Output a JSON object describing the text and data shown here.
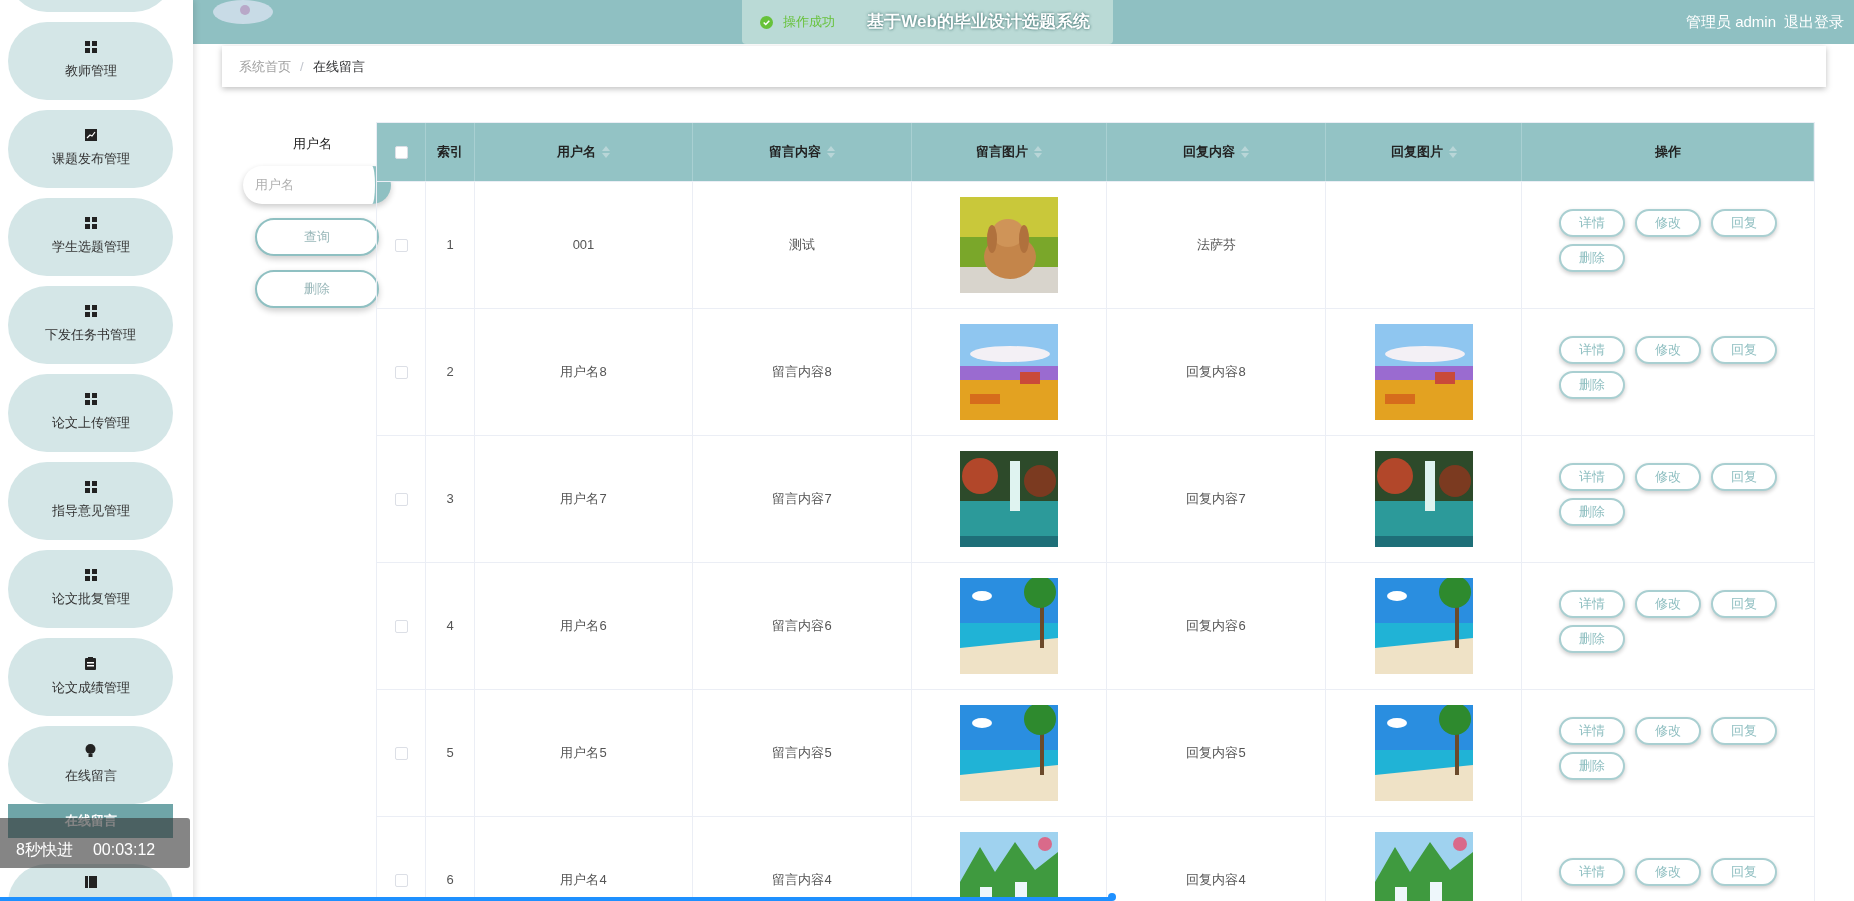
{
  "header": {
    "title": "基于Web的毕业设计选题系统",
    "user": "管理员 admin",
    "logout": "退出登录"
  },
  "toast": {
    "text": "操作成功"
  },
  "sidebar": {
    "items": [
      {
        "label": "教师管理"
      },
      {
        "label": "课题发布管理"
      },
      {
        "label": "学生选题管理"
      },
      {
        "label": "下发任务书管理"
      },
      {
        "label": "论文上传管理"
      },
      {
        "label": "指导意见管理"
      },
      {
        "label": "论文批复管理"
      },
      {
        "label": "论文成绩管理"
      },
      {
        "label": "在线留言",
        "children": [
          {
            "label": "在线留言",
            "selected": true
          }
        ]
      }
    ]
  },
  "breadcrumb": {
    "items": [
      "系统首页",
      "在线留言"
    ],
    "separator": "/"
  },
  "search": {
    "label": "用户名",
    "placeholder": "用户名",
    "buttons": [
      "查询",
      "删除"
    ]
  },
  "table": {
    "select_all": {
      "checked": false
    },
    "columns": [
      {
        "label": "索引",
        "sortable": false
      },
      {
        "label": "用户名",
        "sortable": true
      },
      {
        "label": "留言内容",
        "sortable": true
      },
      {
        "label": "留言图片",
        "sortable": true
      },
      {
        "label": "回复内容",
        "sortable": true
      },
      {
        "label": "回复图片",
        "sortable": true
      },
      {
        "label": "操作",
        "sortable": false
      }
    ],
    "rows": [
      {
        "checked": false,
        "index": "1",
        "username": "001",
        "content": "测试",
        "image": {
          "kind": "picture"
        },
        "reply": "法萨芬",
        "actions": [
          "详情",
          "修改",
          "回复",
          "删除"
        ]
      },
      {
        "checked": false,
        "index": "2",
        "username": "用户名8",
        "content": "留言内容8",
        "image": {
          "kind": "picture"
        },
        "reply": "回复内容8",
        "reply_image": {
          "kind": "picture"
        },
        "actions": [
          "详情",
          "修改",
          "回复",
          "删除"
        ]
      },
      {
        "checked": false,
        "index": "3",
        "username": "用户名7",
        "content": "留言内容7",
        "image": {
          "kind": "picture"
        },
        "reply": "回复内容7",
        "reply_image": {
          "kind": "picture"
        },
        "actions": [
          "详情",
          "修改",
          "回复",
          "删除"
        ]
      },
      {
        "checked": false,
        "index": "4",
        "username": "用户名6",
        "content": "留言内容6",
        "image": {
          "kind": "picture"
        },
        "reply": "回复内容6",
        "reply_image": {
          "kind": "picture"
        },
        "actions": [
          "详情",
          "修改",
          "回复",
          "删除"
        ]
      },
      {
        "checked": false,
        "index": "5",
        "username": "用户名5",
        "content": "留言内容5",
        "image": {
          "kind": "picture"
        },
        "reply": "回复内容5",
        "reply_image": {
          "kind": "picture"
        },
        "actions": [
          "详情",
          "修改",
          "回复",
          "删除"
        ]
      },
      {
        "checked": false,
        "index": "6",
        "username": "用户名4",
        "content": "留言内容4",
        "image": {
          "kind": "picture"
        },
        "reply": "回复内容4",
        "reply_image": {
          "kind": "picture"
        },
        "actions": [
          "详情",
          "修改",
          "回复"
        ]
      }
    ]
  },
  "player": {
    "text": "8秒快进",
    "time": "00:03:12",
    "level": 0.6
  }
}
